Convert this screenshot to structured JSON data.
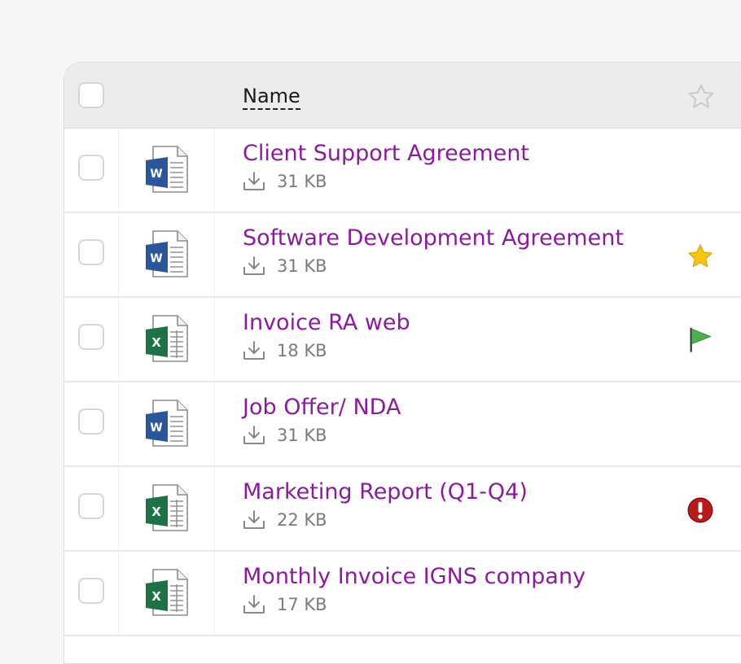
{
  "header": {
    "name_label": "Name"
  },
  "colors": {
    "file_name": "#8a1c9c",
    "word_blue": "#2b579a",
    "excel_green": "#1e7145",
    "star_gold": "#f5c518",
    "flag_green": "#4caf50",
    "alert_red": "#b71c1c"
  },
  "files": [
    {
      "name": "Client Support Agreement",
      "size": "31 KB",
      "type": "word",
      "status": "none"
    },
    {
      "name": "Software Development Agreement",
      "size": "31 KB",
      "type": "word",
      "status": "star-icon"
    },
    {
      "name": "Invoice RA web",
      "size": "18 KB",
      "type": "excel",
      "status": "flag-icon"
    },
    {
      "name": "Job Offer/ NDA",
      "size": "31 KB",
      "type": "word",
      "status": "none"
    },
    {
      "name": "Marketing Report (Q1-Q4)",
      "size": "22 KB",
      "type": "excel",
      "status": "alert-icon"
    },
    {
      "name": "Monthly Invoice IGNS company",
      "size": "17 KB",
      "type": "excel",
      "status": "none"
    }
  ]
}
